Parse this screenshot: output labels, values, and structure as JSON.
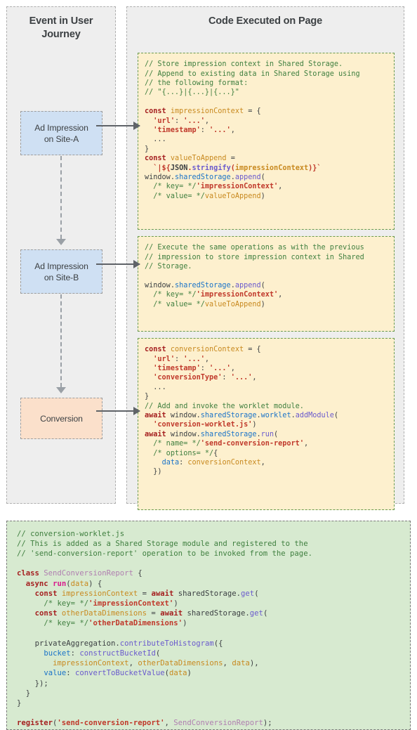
{
  "columns": {
    "journey_title": "Event in User\nJourney",
    "code_title": "Code Executed on Page"
  },
  "journey_nodes": [
    {
      "label": "Ad Impression\non Site-A",
      "type": "impression",
      "color": "#cfe0f3"
    },
    {
      "label": "Ad Impression\non Site-B",
      "type": "impression",
      "color": "#cfe0f3"
    },
    {
      "label": "Conversion",
      "type": "conversion",
      "color": "#fbe0cb"
    }
  ],
  "code_blocks": [
    {
      "id": "impression-site-a-code",
      "background": "#fdf0ce",
      "lines": [
        "// Store impression context in Shared Storage.",
        "// Append to existing data in Shared Storage using",
        "// the following format:",
        "// \"{...}|{...}|{...}\"",
        "",
        "const impressionContext = {",
        "  'url': '...',",
        "  'timestamp': '...',",
        "  ...",
        "}",
        "const valueToAppend =",
        "  `|${JSON.stringify(impressionContext)}`",
        "window.sharedStorage.append(",
        "  /* key= */'impressionContext',",
        "  /* value= */valueToAppend)"
      ]
    },
    {
      "id": "impression-site-b-code",
      "background": "#fdf0ce",
      "lines": [
        "// Execute the same operations as with the previous",
        "// impression to store impression context in Shared",
        "// Storage.",
        "",
        "window.sharedStorage.append(",
        "  /* key= */'impressionContext',",
        "  /* value= */valueToAppend)"
      ]
    },
    {
      "id": "conversion-code",
      "background": "#fdf0ce",
      "lines": [
        "const conversionContext = {",
        "  'url': '...',",
        "  'timestamp': '...',",
        "  'conversionType': '...',",
        "  ...",
        "}",
        "// Add and invoke the worklet module.",
        "await window.sharedStorage.worklet.addModule(",
        "  'conversion-worklet.js')",
        "await window.sharedStorage.run(",
        "  /* name= */'send-conversion-report',",
        "  /* options= */{",
        "    data: conversionContext,",
        "  })"
      ]
    }
  ],
  "worklet_block": {
    "id": "conversion-worklet-code",
    "background": "#d7ead0",
    "lines": [
      "// conversion-worklet.js",
      "// This is added as a Shared Storage module and registered to the",
      "// 'send-conversion-report' operation to be invoked from the page.",
      "",
      "class SendConversionReport {",
      "  async run(data) {",
      "    const impressionContext = await sharedStorage.get(",
      "      /* key= */'impressionContext')",
      "    const otherDataDimensions = await sharedStorage.get(",
      "      /* key= */'otherDataDimensions')",
      "",
      "    privateAggregation.contributeToHistogram({",
      "      bucket: constructBucketId(",
      "        impressionContext, otherDataDimensions, data),",
      "      value: convertToBucketValue(data)",
      "    });",
      "  }",
      "}",
      "",
      "register('send-conversion-report', SendConversionReport);"
    ]
  },
  "colors": {
    "panel_background": "#eeeeee",
    "panel_border": "#b0b0b0",
    "code_border_green": "#6a9a4e",
    "arrow": "#5f6368",
    "connector": "#9aa0a6",
    "comment": "#3f7f3f",
    "keyword": "#a52020",
    "string": "#c0392b",
    "property": "#1a73c8",
    "variable": "#c8891f",
    "function": "#6a5acd",
    "class": "#b07fb0"
  }
}
